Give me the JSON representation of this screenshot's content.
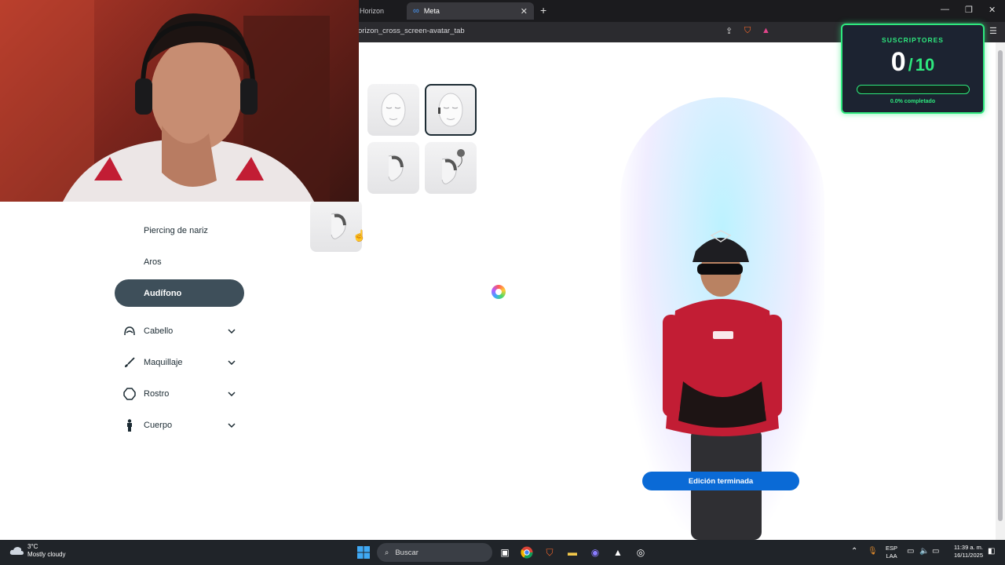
{
  "browser": {
    "tabs": [
      {
        "label": "Horizon"
      },
      {
        "label": "Meta"
      }
    ],
    "new_tab_label": "+",
    "url": "orizon_cross_screen-avatar_tab"
  },
  "editor": {
    "menu_items": [
      {
        "label": "Piercing de nariz"
      },
      {
        "label": "Aros"
      },
      {
        "label": "Audífono"
      }
    ],
    "categories": [
      {
        "label": "Cabello",
        "icon": "hair-icon"
      },
      {
        "label": "Maquillaje",
        "icon": "brush-icon"
      },
      {
        "label": "Rostro",
        "icon": "face-icon"
      },
      {
        "label": "Cuerpo",
        "icon": "body-icon"
      }
    ],
    "finish_button": "Edición terminada"
  },
  "subscribers": {
    "title": "SUSCRIPTORES",
    "current": "0",
    "separator": "/",
    "goal": "10",
    "progress_fraction": 0.0,
    "progress_text": "0.0% completado",
    "accent": "#2ee87e"
  },
  "taskbar": {
    "weather_temp": "3°C",
    "weather_desc": "Mostly cloudy",
    "search_placeholder": "Buscar",
    "lang_line1": "ESP",
    "lang_line2": "LAA",
    "time": "11:39 a. m.",
    "date": "16/11/2025"
  },
  "colors": {
    "active_menu": "#3e4f5a",
    "primary_button": "#0a6ad6",
    "taskbar": "#202429"
  }
}
